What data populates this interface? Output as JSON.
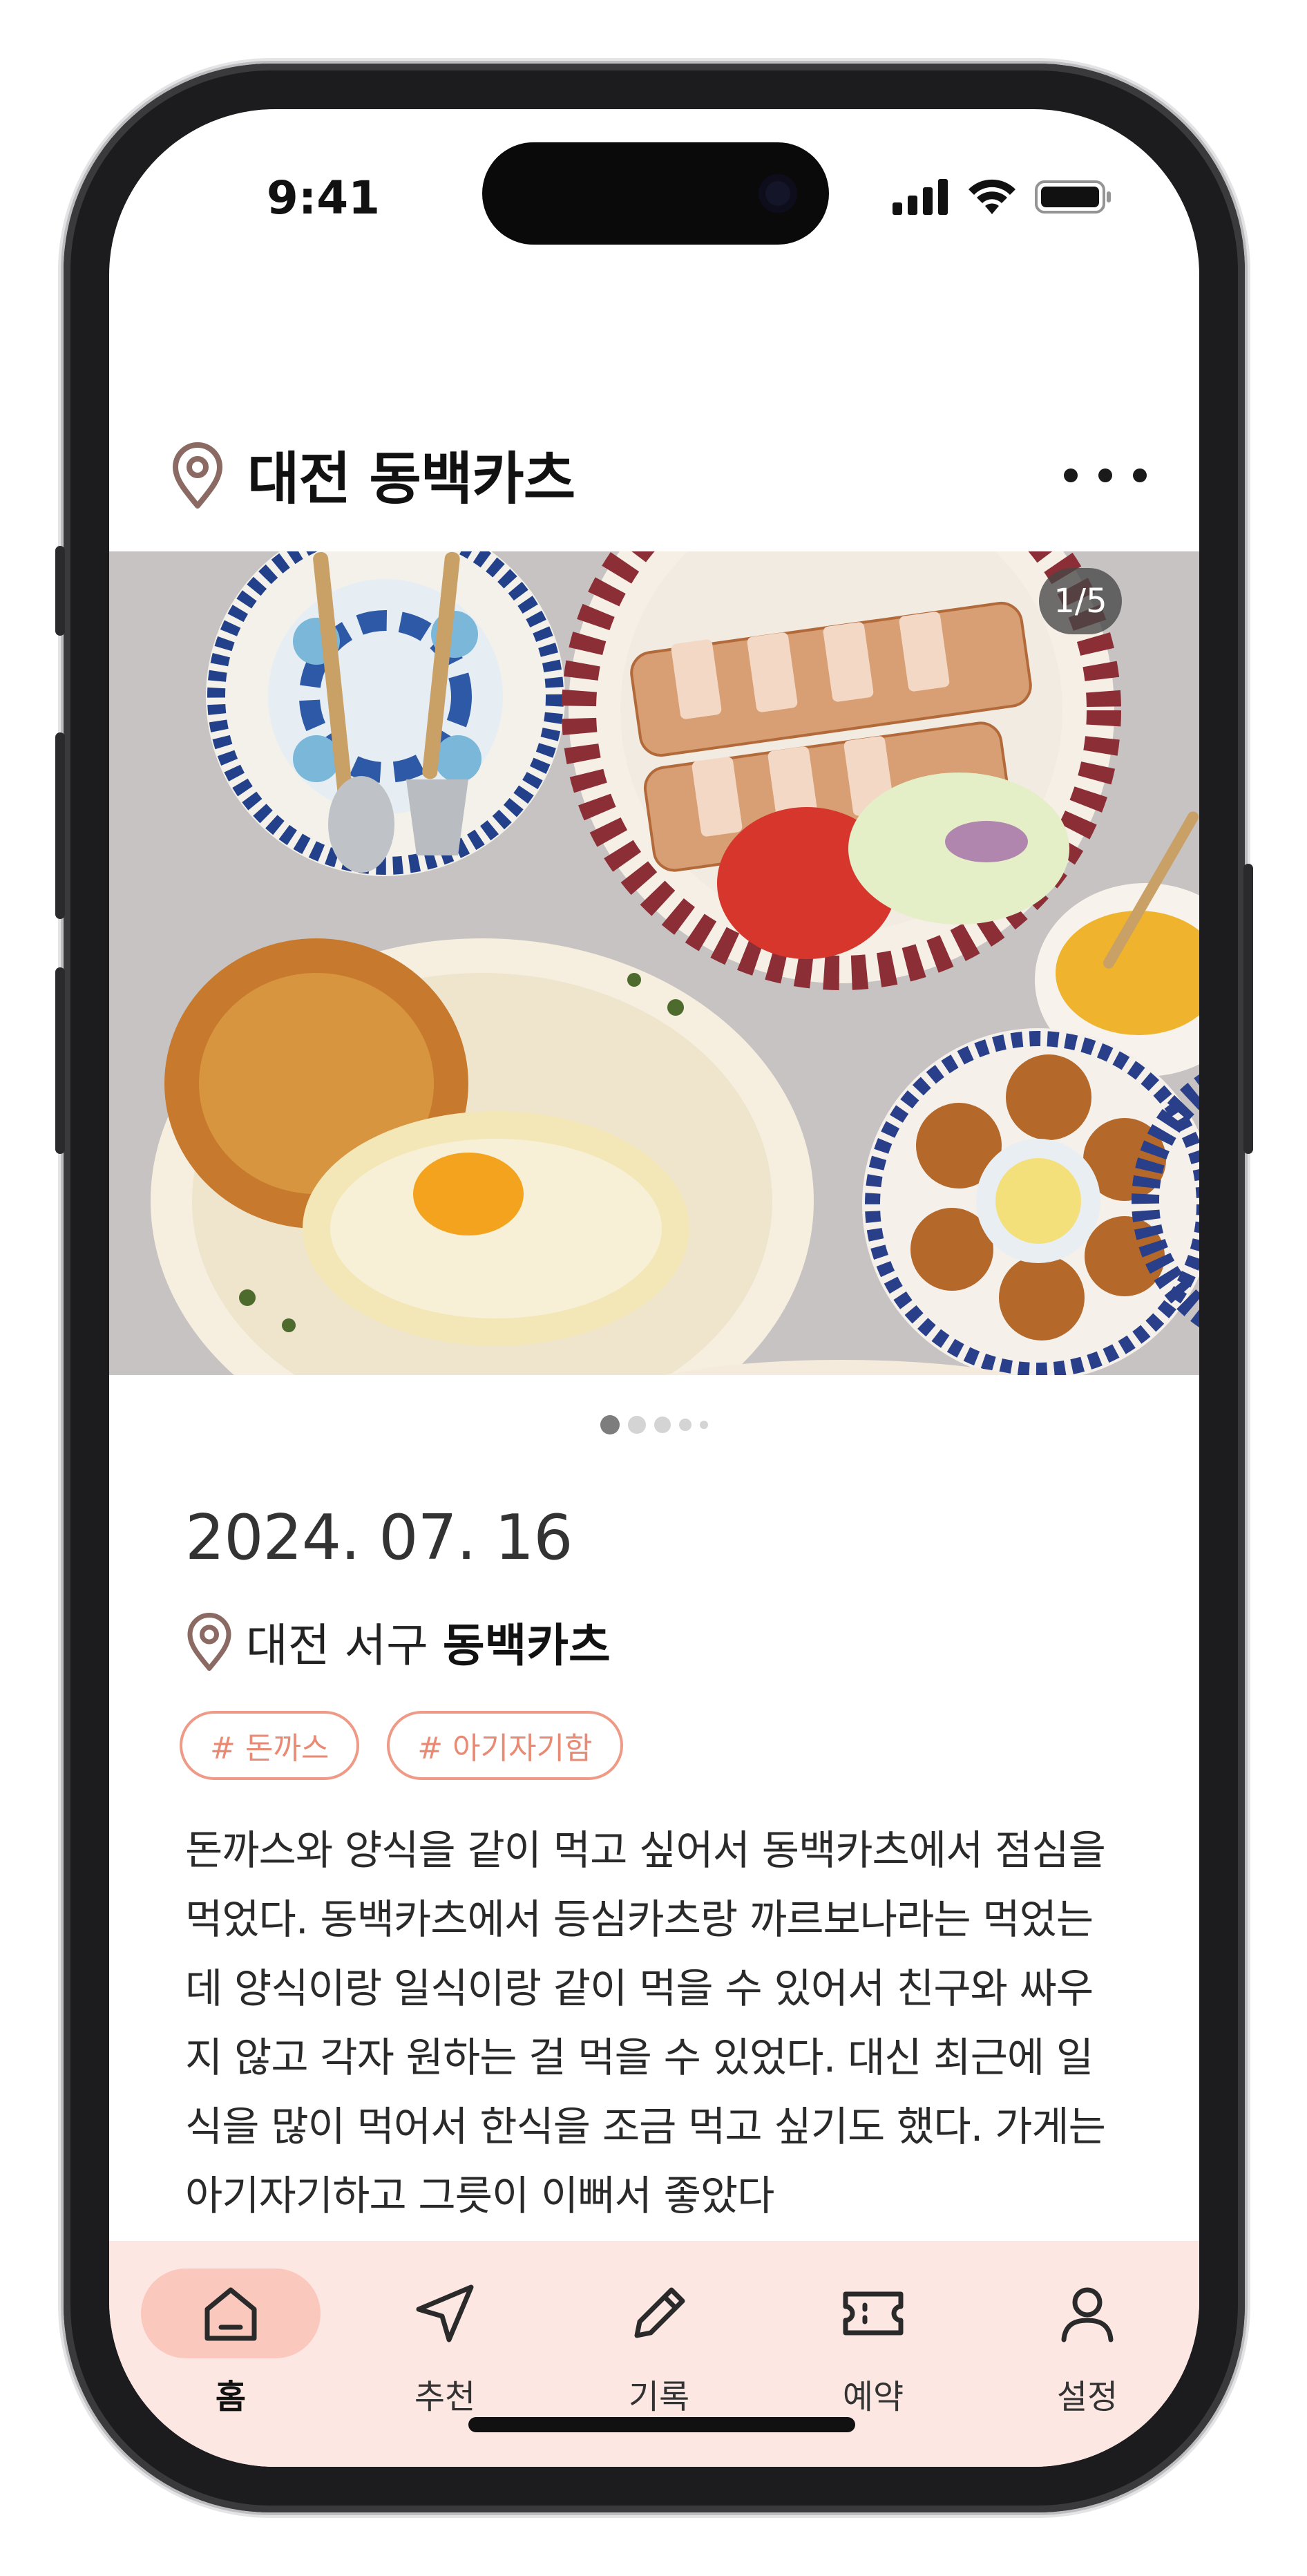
{
  "status_bar": {
    "time": "9:41"
  },
  "header": {
    "title": "대전 동백카츠",
    "location_icon": "map-pin-icon",
    "more_icon": "more-horizontal-icon"
  },
  "photo": {
    "counter": "1/5",
    "current_index": 1,
    "total": 5
  },
  "post": {
    "date": "2024. 07. 16",
    "location_prefix": "대전 서구",
    "location_name": "동백카츠",
    "tags": [
      "# 돈까스",
      "# 아기자기함"
    ],
    "body": "돈까스와 양식을 같이 먹고 싶어서 동백카츠에서 점심을\n먹었다. 동백카츠에서 등심카츠랑 까르보나라는 먹었는\n데 양식이랑 일식이랑 같이 먹을 수 있어서 친구와 싸우\n지 않고 각자 원하는 걸 먹을 수 있었다. 대신 최근에 일\n식을 많이 먹어서 한식을 조금 먹고 싶기도 했다. 가게는\n아기자기하고 그릇이 이뻐서 좋았다"
  },
  "tabbar": {
    "items": [
      {
        "label": "홈",
        "icon": "home-icon",
        "active": true
      },
      {
        "label": "추천",
        "icon": "navigation-arrow-icon",
        "active": false
      },
      {
        "label": "기록",
        "icon": "pencil-icon",
        "active": false
      },
      {
        "label": "예약",
        "icon": "ticket-icon",
        "active": false
      },
      {
        "label": "설정",
        "icon": "user-icon",
        "active": false
      }
    ]
  },
  "colors": {
    "accent": "#ef9a86",
    "tabbar_bg": "#fde7e3",
    "active_tab_bg": "#fbc8bd",
    "pin_icon": "#8a6a62"
  }
}
